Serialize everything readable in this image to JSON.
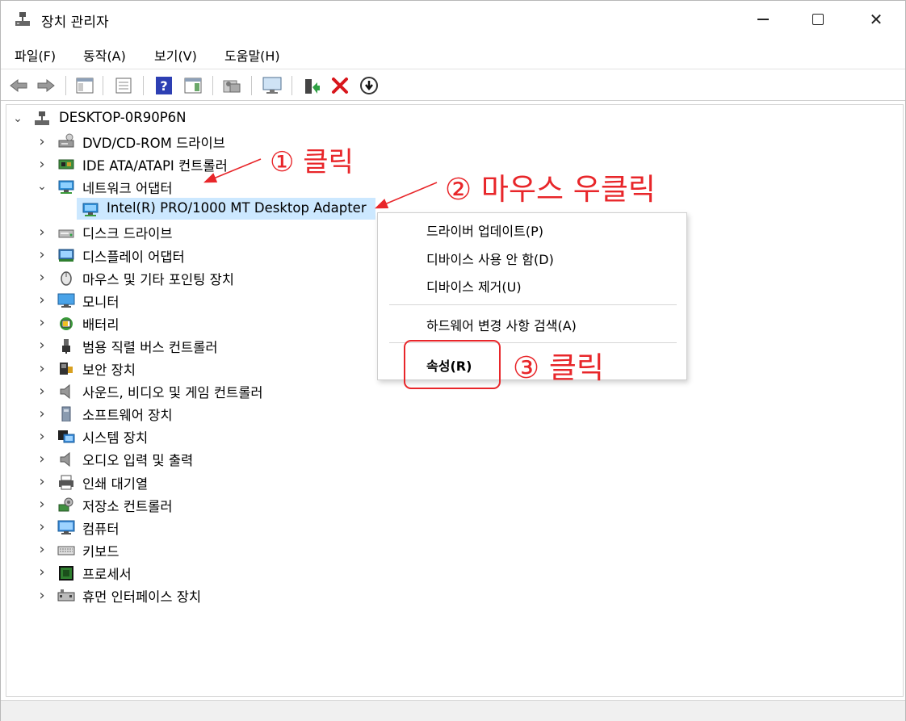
{
  "window": {
    "title": "장치 관리자",
    "controls": {
      "minimize": "minimize",
      "maximize": "maximize",
      "close": "✕"
    }
  },
  "menu": {
    "items": [
      "파일(F)",
      "동작(A)",
      "보기(V)",
      "도움말(H)"
    ]
  },
  "toolbar": {
    "buttons": [
      "back-arrow-icon",
      "forward-arrow-icon",
      "show-hide-console-tree-icon",
      "properties-icon",
      "help-icon",
      "action-pane-icon",
      "scan-hardware-icon",
      "monitor-icon",
      "update-driver-icon",
      "uninstall-icon",
      "disable-device-icon"
    ]
  },
  "tree": {
    "root": "DESKTOP-0R90P6N",
    "items": [
      {
        "label": "DVD/CD-ROM 드라이브",
        "icon": "dvd-drive-icon"
      },
      {
        "label": "IDE ATA/ATAPI 컨트롤러",
        "icon": "ide-controller-icon"
      },
      {
        "label": "네트워크 어댑터",
        "icon": "network-adapter-icon",
        "expanded": true
      },
      {
        "label": "Intel(R) PRO/1000 MT Desktop Adapter",
        "icon": "network-adapter-icon",
        "child": true,
        "selected": true
      },
      {
        "label": "디스크 드라이브",
        "icon": "disk-drive-icon"
      },
      {
        "label": "디스플레이 어댑터",
        "icon": "display-adapter-icon"
      },
      {
        "label": "마우스 및 기타 포인팅 장치",
        "icon": "mouse-icon"
      },
      {
        "label": "모니터",
        "icon": "monitor-icon"
      },
      {
        "label": "배터리",
        "icon": "battery-icon"
      },
      {
        "label": "범용 직렬 버스 컨트롤러",
        "icon": "usb-icon"
      },
      {
        "label": "보안 장치",
        "icon": "security-device-icon"
      },
      {
        "label": "사운드, 비디오 및 게임 컨트롤러",
        "icon": "speaker-icon"
      },
      {
        "label": "소프트웨어 장치",
        "icon": "software-device-icon"
      },
      {
        "label": "시스템 장치",
        "icon": "system-device-icon"
      },
      {
        "label": "오디오 입력 및 출력",
        "icon": "speaker-icon"
      },
      {
        "label": "인쇄 대기열",
        "icon": "printer-icon"
      },
      {
        "label": "저장소 컨트롤러",
        "icon": "storage-controller-icon"
      },
      {
        "label": "컴퓨터",
        "icon": "computer-icon"
      },
      {
        "label": "키보드",
        "icon": "keyboard-icon"
      },
      {
        "label": "프로세서",
        "icon": "processor-icon"
      },
      {
        "label": "휴먼 인터페이스 장치",
        "icon": "hid-icon"
      }
    ]
  },
  "context_menu": {
    "update_driver": "드라이버 업데이트(P)",
    "disable_device": "디바이스 사용 안 함(D)",
    "uninstall_device": "디바이스 제거(U)",
    "scan_hardware": "하드웨어 변경 사항 검색(A)",
    "properties": "속성(R)"
  },
  "annotations": {
    "step1": "① 클릭",
    "step2": "② 마우스 우클릭",
    "step3": "③ 클릭"
  },
  "colors": {
    "selection": "#cce8ff",
    "annotation": "#e8262a"
  }
}
